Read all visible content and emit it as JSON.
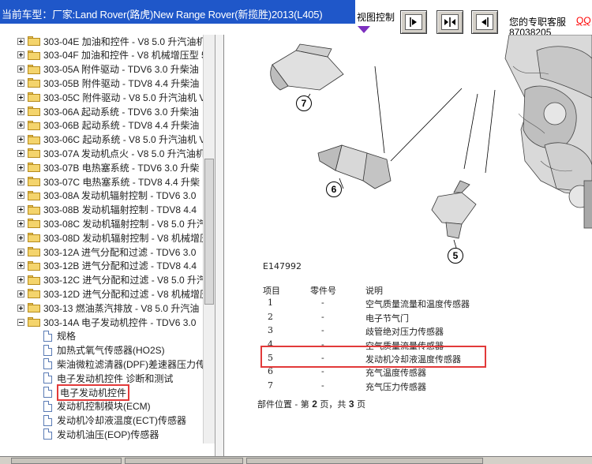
{
  "header": {
    "title": "当前车型：厂家:Land Rover(路虎)New Range Rover(新揽胜)2013(L405)",
    "view_label": "视图控制",
    "support_label": "您的专职客服",
    "qq_label": "QQ",
    "phone": "87038205",
    "colors": {
      "title_bar": "#1f57c9",
      "highlight": "#e23a3a",
      "qq": "#ff0000"
    }
  },
  "tree": {
    "folders": [
      {
        "label": "303-04E 加油和控件 - V8 5.0 升汽油机"
      },
      {
        "label": "303-04F 加油和控件 - V8 机械增压型 5"
      },
      {
        "label": "303-05A 附件驱动 - TDV6 3.0 升柴油"
      },
      {
        "label": "303-05B 附件驱动 - TDV8 4.4 升柴油"
      },
      {
        "label": "303-05C 附件驱动 - V8 5.0 升汽油机 V"
      },
      {
        "label": "303-06A 起动系统 - TDV6 3.0 升柴油"
      },
      {
        "label": "303-06B 起动系统 - TDV8 4.4 升柴油"
      },
      {
        "label": "303-06C 起动系统 - V8 5.0 升汽油机 V"
      },
      {
        "label": "303-07A 发动机点火 - V8 5.0 升汽油机"
      },
      {
        "label": "303-07B 电热塞系统 - TDV6 3.0 升柴"
      },
      {
        "label": "303-07C 电热塞系统 - TDV8 4.4 升柴"
      },
      {
        "label": "303-08A 发动机辐射控制 - TDV6 3.0"
      },
      {
        "label": "303-08B 发动机辐射控制 - TDV8 4.4"
      },
      {
        "label": "303-08C 发动机辐射控制 - V8 5.0 升汽"
      },
      {
        "label": "303-08D 发动机辐射控制 - V8 机械增压"
      },
      {
        "label": "303-12A 进气分配和过滤 - TDV6 3.0"
      },
      {
        "label": "303-12B 进气分配和过滤 - TDV8 4.4"
      },
      {
        "label": "303-12C 进气分配和过滤 - V8 5.0 升汽"
      },
      {
        "label": "303-12D 进气分配和过滤 - V8 机械增压"
      },
      {
        "label": "303-13 燃油蒸汽排放 - V8 5.0 升汽油"
      },
      {
        "label": "303-14A 电子发动机控件 - TDV6 3.0"
      }
    ],
    "docs": [
      {
        "label": "规格"
      },
      {
        "label": "加热式氧气传感器(HO2S)"
      },
      {
        "label": "柴油微粒滤清器(DPF)差速器压力传感"
      },
      {
        "label": "电子发动机控件 诊断和测试"
      },
      {
        "label": "电子发动机控件"
      },
      {
        "label": "发动机控制模块(ECM)"
      },
      {
        "label": "发动机冷却液温度(ECT)传感器"
      },
      {
        "label": "发动机油压(EOP)传感器"
      }
    ],
    "selected_doc": "电子发动机控件"
  },
  "document": {
    "figure_code": "E147992",
    "callouts": [
      "7",
      "6",
      "5"
    ],
    "table": {
      "headers": [
        "项目",
        "零件号",
        "说明"
      ],
      "rows": [
        {
          "item": "1",
          "part": "-",
          "desc": "空气质量流量和温度传感器"
        },
        {
          "item": "2",
          "part": "-",
          "desc": "电子节气门"
        },
        {
          "item": "3",
          "part": "-",
          "desc": "歧管绝对压力传感器"
        },
        {
          "item": "4",
          "part": "-",
          "desc": "空气质量流量传感器"
        },
        {
          "item": "5",
          "part": "-",
          "desc": "发动机冷却液温度传感器"
        },
        {
          "item": "6",
          "part": "-",
          "desc": "充气温度传感器"
        },
        {
          "item": "7",
          "part": "-",
          "desc": "充气压力传感器"
        }
      ],
      "highlighted_item": "5"
    },
    "page_position": {
      "prefix": "部件位置 - 第 ",
      "current": "2",
      "middle": " 页，共 ",
      "total": "3",
      "suffix": " 页"
    }
  },
  "icons": {
    "folder": "folder-icon",
    "doc": "document-icon",
    "expand": "plus-expander-icon",
    "collapse": "minus-expander-icon",
    "view1": "view-right-icon",
    "view2": "view-split-icon",
    "view3": "view-left-icon"
  }
}
